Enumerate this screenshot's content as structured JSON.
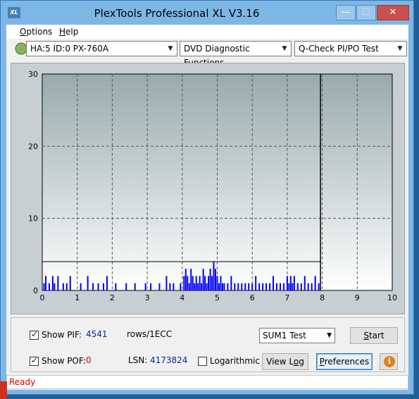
{
  "window": {
    "title": "PlexTools Professional XL V3.16",
    "icon_text": "XL",
    "min_glyph": "—",
    "max_glyph": "☐",
    "close_glyph": "✕"
  },
  "menu": {
    "options": "O",
    "options_rest": "ptions",
    "help": "H",
    "help_rest": "elp"
  },
  "toolbar": {
    "drive": "HA:5 ID:0  PX-760A",
    "function": "DVD Diagnostic Functions",
    "test": "Q-Check PI/PO Test",
    "arrow": "▼"
  },
  "chart_data": {
    "type": "bar",
    "title": "",
    "xlabel": "",
    "ylabel": "",
    "xlim": [
      0,
      10
    ],
    "ylim": [
      0,
      30
    ],
    "x_ticks": [
      "0",
      "1",
      "2",
      "3",
      "4",
      "5",
      "6",
      "7",
      "8",
      "9",
      "10"
    ],
    "y_ticks": [
      "0",
      "10",
      "20",
      "30"
    ],
    "threshold_line": 4,
    "end_marker_x": 7.95,
    "grid": true,
    "series": [
      {
        "color": "#0000ff",
        "x": [
          0.05,
          0.1,
          0.2,
          0.3,
          0.35,
          0.45,
          0.6,
          0.7,
          0.8,
          1.1,
          1.3,
          1.45,
          1.6,
          1.75,
          1.85,
          2.1,
          2.4,
          2.65,
          2.95,
          3.1,
          3.35,
          3.55,
          3.65,
          3.75,
          3.95,
          4.05,
          4.1,
          4.15,
          4.2,
          4.25,
          4.3,
          4.35,
          4.4,
          4.45,
          4.5,
          4.55,
          4.6,
          4.65,
          4.7,
          4.75,
          4.8,
          4.85,
          4.9,
          4.95,
          5.0,
          5.05,
          5.1,
          5.15,
          5.2,
          5.3,
          5.4,
          5.5,
          5.6,
          5.7,
          5.8,
          5.9,
          6.0,
          6.1,
          6.2,
          6.3,
          6.4,
          6.5,
          6.6,
          6.7,
          6.8,
          6.9,
          7.0,
          7.05,
          7.1,
          7.15,
          7.2,
          7.3,
          7.4,
          7.5,
          7.6,
          7.7,
          7.8,
          7.9
        ],
        "y": [
          1,
          2,
          1,
          2,
          1,
          2,
          1,
          1,
          2,
          1,
          2,
          1,
          1,
          1,
          2,
          1,
          1,
          1,
          1,
          1,
          1,
          2,
          1,
          1,
          1,
          2,
          3,
          2,
          1,
          3,
          2,
          1,
          2,
          1,
          2,
          1,
          3,
          2,
          1,
          2,
          3,
          2,
          4,
          3,
          2,
          1,
          2,
          1,
          1,
          1,
          2,
          1,
          1,
          1,
          1,
          1,
          1,
          2,
          1,
          1,
          1,
          1,
          2,
          1,
          1,
          1,
          2,
          1,
          2,
          1,
          2,
          1,
          1,
          2,
          1,
          1,
          2,
          1
        ]
      }
    ]
  },
  "bottom": {
    "show_pif": "Show PIF:",
    "pif_value": "4541",
    "pif_unit": "rows/1ECC",
    "show_pof": "Show POF:",
    "pof_value": "0",
    "lsn_label": "LSN:",
    "lsn_value": "4173824",
    "logarithmic": "Logarithmic",
    "sum_select": "SUM1 Test",
    "start": "S",
    "start_rest": "tart",
    "view_log": "View L",
    "view_log_u": "o",
    "view_log_rest": "g",
    "preferences": "P",
    "preferences_rest": "references",
    "info": "i"
  },
  "status": {
    "text": "Ready"
  },
  "colors": {
    "titlebar": "#7db7e6",
    "bar": "#0000ff",
    "status_text": "#d00000",
    "value_text": "#0a2a8a"
  }
}
